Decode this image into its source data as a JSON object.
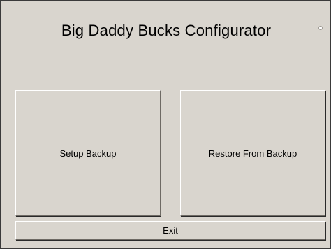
{
  "window": {
    "title": "Big Daddy Bucks Configurator"
  },
  "buttons": {
    "setup_backup": "Setup Backup",
    "restore_from_backup": "Restore From Backup",
    "exit": "Exit"
  },
  "colors": {
    "window_background": "#d9d5ce",
    "button_face": "#d9d5ce",
    "text": "#000000"
  }
}
